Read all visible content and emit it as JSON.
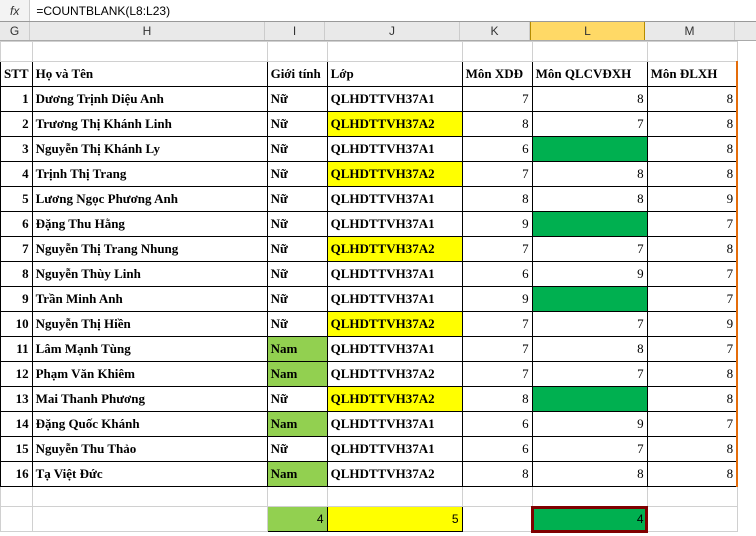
{
  "formula_bar": {
    "fx": "fx",
    "formula": "=COUNTBLANK(L8:L23)"
  },
  "column_letters": {
    "G": "G",
    "H": "H",
    "I": "I",
    "J": "J",
    "K": "K",
    "L": "L",
    "M": "M"
  },
  "header": {
    "stt": "STT",
    "name": "Họ và Tên",
    "gender": "Giới tính",
    "class": "Lớp",
    "xdd": "Môn XDĐ",
    "qlcvdxh": "Môn QLCVĐXH",
    "dlxh": "Môn ĐLXH"
  },
  "rows": [
    {
      "stt": "1",
      "name": "Dương Trịnh Diệu Anh",
      "gender": "Nữ",
      "g_hl": false,
      "class": "QLHDTTVH37A1",
      "c_hl": false,
      "xdd": "7",
      "ql": "8",
      "ql_green": false,
      "dl": "8"
    },
    {
      "stt": "2",
      "name": "Trương Thị Khánh Linh",
      "gender": "Nữ",
      "g_hl": false,
      "class": "QLHDTTVH37A2",
      "c_hl": true,
      "xdd": "8",
      "ql": "7",
      "ql_green": false,
      "dl": "8"
    },
    {
      "stt": "3",
      "name": "Nguyễn Thị Khánh Ly",
      "gender": "Nữ",
      "g_hl": false,
      "class": "QLHDTTVH37A1",
      "c_hl": false,
      "xdd": "6",
      "ql": "",
      "ql_green": true,
      "dl": "8"
    },
    {
      "stt": "4",
      "name": "Trịnh Thị Trang",
      "gender": "Nữ",
      "g_hl": false,
      "class": "QLHDTTVH37A2",
      "c_hl": true,
      "xdd": "7",
      "ql": "8",
      "ql_green": false,
      "dl": "8"
    },
    {
      "stt": "5",
      "name": "Lương Ngọc Phương Anh",
      "gender": "Nữ",
      "g_hl": false,
      "class": "QLHDTTVH37A1",
      "c_hl": false,
      "xdd": "8",
      "ql": "8",
      "ql_green": false,
      "dl": "9"
    },
    {
      "stt": "6",
      "name": "Đặng Thu Hằng",
      "gender": "Nữ",
      "g_hl": false,
      "class": "QLHDTTVH37A1",
      "c_hl": false,
      "xdd": "9",
      "ql": "",
      "ql_green": true,
      "dl": "7"
    },
    {
      "stt": "7",
      "name": "Nguyễn Thị Trang Nhung",
      "gender": "Nữ",
      "g_hl": false,
      "class": "QLHDTTVH37A2",
      "c_hl": true,
      "xdd": "7",
      "ql": "7",
      "ql_green": false,
      "dl": "8"
    },
    {
      "stt": "8",
      "name": "Nguyễn Thùy Linh",
      "gender": "Nữ",
      "g_hl": false,
      "class": "QLHDTTVH37A1",
      "c_hl": false,
      "xdd": "6",
      "ql": "9",
      "ql_green": false,
      "dl": "7"
    },
    {
      "stt": "9",
      "name": "Trần Minh Anh",
      "gender": "Nữ",
      "g_hl": false,
      "class": "QLHDTTVH37A1",
      "c_hl": false,
      "xdd": "9",
      "ql": "",
      "ql_green": true,
      "dl": "7"
    },
    {
      "stt": "10",
      "name": "Nguyễn Thị Hiền",
      "gender": "Nữ",
      "g_hl": false,
      "class": "QLHDTTVH37A2",
      "c_hl": true,
      "xdd": "7",
      "ql": "7",
      "ql_green": false,
      "dl": "9"
    },
    {
      "stt": "11",
      "name": "Lâm Mạnh Tùng",
      "gender": "Nam",
      "g_hl": true,
      "class": "QLHDTTVH37A1",
      "c_hl": false,
      "xdd": "7",
      "ql": "8",
      "ql_green": false,
      "dl": "7"
    },
    {
      "stt": "12",
      "name": "Phạm Văn Khiêm",
      "gender": "Nam",
      "g_hl": true,
      "class": "QLHDTTVH37A2",
      "c_hl": false,
      "xdd": "7",
      "ql": "7",
      "ql_green": false,
      "dl": "8"
    },
    {
      "stt": "13",
      "name": "Mai Thanh Phương",
      "gender": "Nữ",
      "g_hl": false,
      "class": "QLHDTTVH37A2",
      "c_hl": true,
      "xdd": "8",
      "ql": "",
      "ql_green": true,
      "dl": "8"
    },
    {
      "stt": "14",
      "name": "Đặng Quốc Khánh",
      "gender": "Nam",
      "g_hl": true,
      "class": "QLHDTTVH37A1",
      "c_hl": false,
      "xdd": "6",
      "ql": "9",
      "ql_green": false,
      "dl": "7"
    },
    {
      "stt": "15",
      "name": "Nguyễn Thu Thảo",
      "gender": "Nữ",
      "g_hl": false,
      "class": "QLHDTTVH37A1",
      "c_hl": false,
      "xdd": "6",
      "ql": "7",
      "ql_green": false,
      "dl": "8"
    },
    {
      "stt": "16",
      "name": "Tạ Việt Đức",
      "gender": "Nam",
      "g_hl": true,
      "class": "QLHDTTVH37A2",
      "c_hl": false,
      "xdd": "8",
      "ql": "8",
      "ql_green": false,
      "dl": "8"
    }
  ],
  "summary": {
    "count_gender": "4",
    "count_class": "5",
    "count_ql": "4"
  }
}
